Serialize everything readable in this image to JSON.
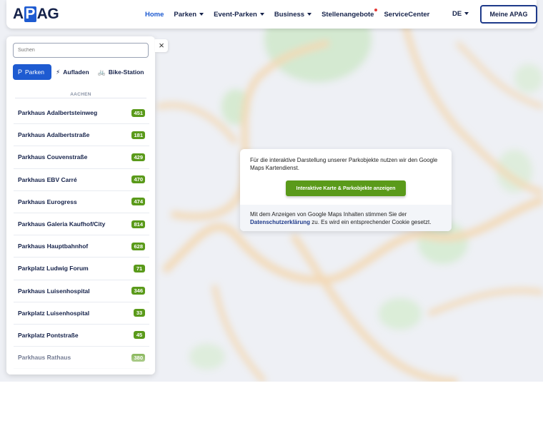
{
  "header": {
    "logo": {
      "pre": "A",
      "box": "P",
      "post": "AG"
    },
    "nav": [
      {
        "label": "Home",
        "active": true,
        "dropdown": false,
        "dot": false
      },
      {
        "label": "Parken",
        "active": false,
        "dropdown": true,
        "dot": false
      },
      {
        "label": "Event-Parken",
        "active": false,
        "dropdown": true,
        "dot": false
      },
      {
        "label": "Business",
        "active": false,
        "dropdown": true,
        "dot": false
      },
      {
        "label": "Stellenangebote",
        "active": false,
        "dropdown": false,
        "dot": true
      },
      {
        "label": "ServiceCenter",
        "active": false,
        "dropdown": false,
        "dot": false
      }
    ],
    "language": "DE",
    "account_button": "Meine APAG"
  },
  "sidebar": {
    "search_placeholder": "Suchen",
    "close_icon": "×",
    "tabs": [
      {
        "label": "Parken",
        "icon": "parking-icon",
        "glyph": "P",
        "active": true
      },
      {
        "label": "Aufladen",
        "icon": "charging-icon",
        "glyph": "⚡",
        "active": false
      },
      {
        "label": "Bike-Station",
        "icon": "bike-icon",
        "glyph": "🚲",
        "active": false
      }
    ],
    "section_title": "AACHEN",
    "items": [
      {
        "name": "Parkhaus Adalbertsteinweg",
        "count": "451"
      },
      {
        "name": "Parkhaus Adalbertstraße",
        "count": "181"
      },
      {
        "name": "Parkhaus Couvenstraße",
        "count": "429"
      },
      {
        "name": "Parkhaus EBV Carré",
        "count": "470"
      },
      {
        "name": "Parkhaus Eurogress",
        "count": "474"
      },
      {
        "name": "Parkhaus Galeria Kaufhof/City",
        "count": "814"
      },
      {
        "name": "Parkhaus Hauptbahnhof",
        "count": "628"
      },
      {
        "name": "Parkplatz Ludwig Forum",
        "count": "71"
      },
      {
        "name": "Parkhaus Luisenhospital",
        "count": "346"
      },
      {
        "name": "Parkplatz Luisenhospital",
        "count": "33"
      },
      {
        "name": "Parkplatz Pontstraße",
        "count": "45"
      },
      {
        "name": "Parkhaus Rathaus",
        "count": "380"
      }
    ],
    "badge_color": "#5a9a1a"
  },
  "consent": {
    "intro": "Für die interaktive Darstellung unserer Parkobjekte nutzen wir den Google Maps Kartendienst.",
    "button": "Interaktive Karte & Parkobjekte anzeigen",
    "notice_pre": "Mit dem Anzeigen von Google Maps Inhalten stimmen Sie der",
    "notice_link": "Datenschutzerklärung",
    "notice_post": "zu. Es wird ein entsprechender Cookie gesetzt."
  },
  "colors": {
    "brand_blue": "#1e5bd1",
    "navy": "#15224a",
    "green": "#5a9a1a"
  }
}
